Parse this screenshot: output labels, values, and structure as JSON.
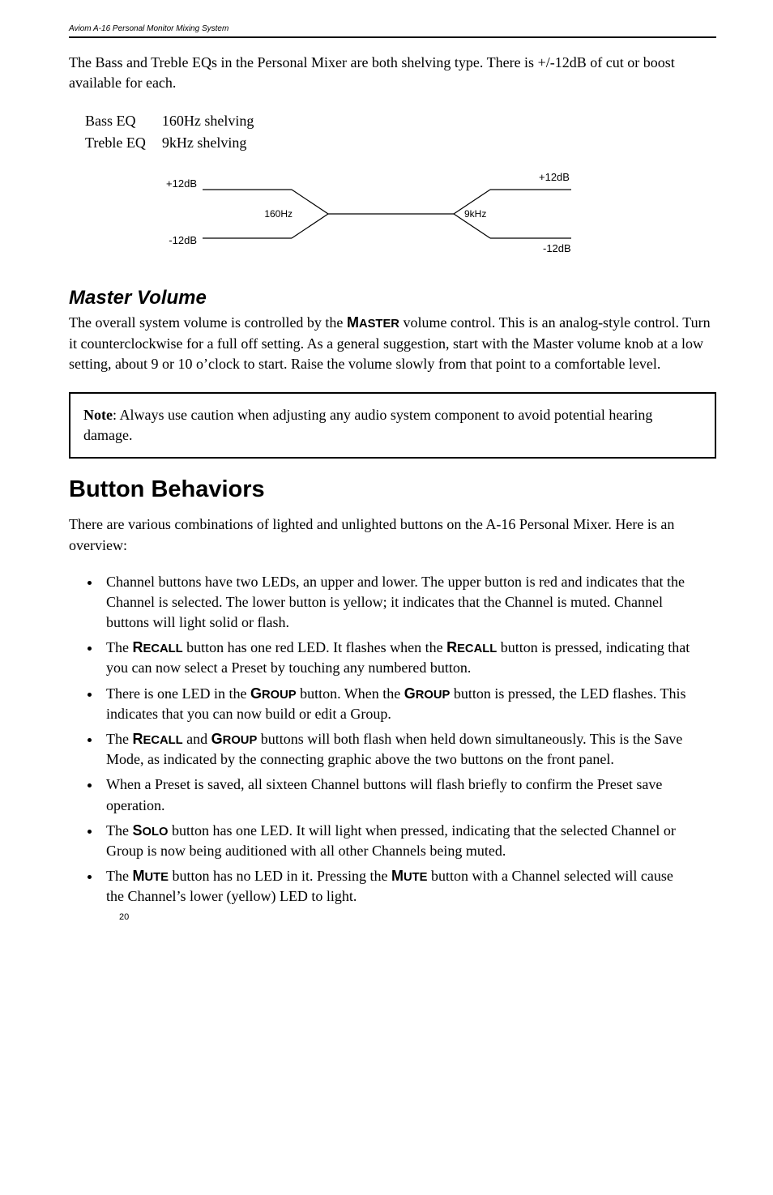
{
  "header": "Aviom A-16 Personal Monitor Mixing System",
  "intro": "The Bass and Treble EQs in the Personal Mixer are both shelving type. There is +/-12dB of cut or boost available for each.",
  "eq": {
    "rows": [
      {
        "label": "Bass EQ",
        "value": "160Hz shelving"
      },
      {
        "label": "Treble EQ",
        "value": "9kHz shelving"
      }
    ]
  },
  "diagram": {
    "top_left": "+12dB",
    "top_right": "+12dB",
    "bottom_left": "-12dB",
    "bottom_right": "-12dB",
    "freq_low": "160Hz",
    "freq_high": "9kHz"
  },
  "master": {
    "heading": "Master Volume",
    "p1a": "The overall system volume is controlled by the ",
    "p1word": "Master",
    "p1b": " volume control. This is an analog-style control. Turn it counterclockwise for a full off setting. As a general suggestion, start with the Master volume knob at a low setting, about 9 or 10 o’clock to start. Raise the volume slowly from that point to a comfortable level."
  },
  "note": {
    "label": "Note",
    "text": ": Always use caution when adjusting any audio system component to avoid potential hearing damage."
  },
  "behaviors": {
    "heading": "Button Behaviors",
    "intro": "There are various combinations of lighted and unlighted buttons on the A-16 Personal Mixer. Here is an overview:",
    "items": [
      {
        "pre": "Channel buttons have two LEDs, an upper and lower. The upper button is red and indicates that the Channel is selected. The lower button is yellow; it indicates that the Channel is muted. Channel buttons will light solid or flash."
      },
      {
        "pre": "The ",
        "sc1": "Recall",
        "mid": " button has one red LED. It flashes when the ",
        "sc2": "Recall",
        "post": " button is pressed, indicating that you can now select a Preset by touching any numbered button."
      },
      {
        "pre": "There is one LED in the ",
        "sc1": "Group",
        "mid": " button. When the ",
        "sc2": "Group",
        "post": " button is pressed, the LED flashes. This indicates that you can now build or edit a Group."
      },
      {
        "pre": "The ",
        "sc1": "Recall",
        "mid": " and ",
        "sc2": "Group",
        "post": " buttons will both flash when held down simultaneously. This is the Save Mode, as indicated by the connecting graphic above the two buttons on the front panel."
      },
      {
        "pre": "When a Preset is saved, all sixteen Channel buttons will flash briefly to confirm the Preset save operation."
      },
      {
        "pre": "The ",
        "sc1": "Solo",
        "post": " button has one LED. It will light when pressed, indicating that the selected Channel or Group is now being auditioned with all other Channels being muted."
      },
      {
        "pre": "The ",
        "sc1": "Mute",
        "mid": " button has no LED in it. Pressing the ",
        "sc2": "Mute",
        "post": " button with a Channel selected will cause the Channel’s lower (yellow) LED to light."
      }
    ]
  },
  "pagenum": "20"
}
